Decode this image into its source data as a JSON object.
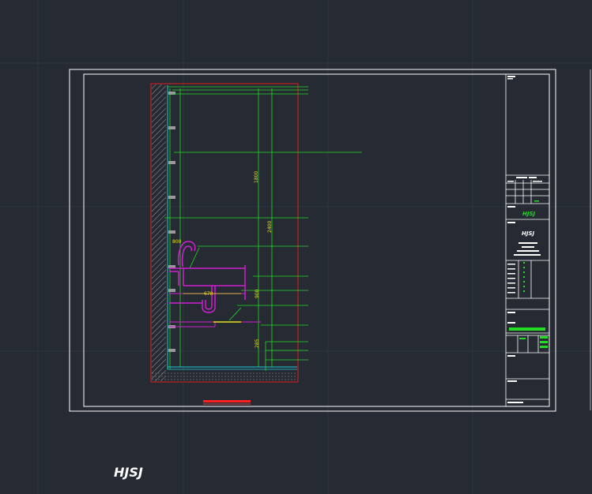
{
  "app": {
    "canvas_background": "#252a33",
    "grid_color": "#2f3540"
  },
  "drawing": {
    "dimensions": {
      "d1800": "1800",
      "d2400": "2400",
      "d800": "800",
      "d900": "900",
      "d670": "670",
      "d285": "285"
    },
    "logo_text": "HJSJ",
    "title_block_logo": "HJSJ",
    "colors": {
      "frame": "#ffffff",
      "wall_outline": "#e02020",
      "leader_green": "#22dd22",
      "pipe_magenta": "#d020d0",
      "dim_yellow": "#e8e020",
      "floor_cyan": "#20c8d8",
      "scale_bar_red": "#ff2020"
    }
  }
}
